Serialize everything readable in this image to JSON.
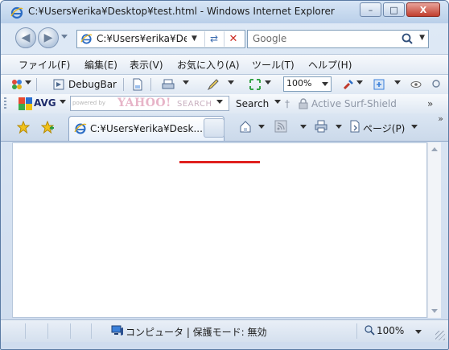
{
  "window": {
    "title": "C:¥Users¥erika¥Desktop¥test.html - Windows Internet Explorer",
    "buttons": {
      "minimize": "–",
      "maximize": "□",
      "close": "X"
    }
  },
  "address_bar": {
    "url": "C:¥Users¥erika¥De",
    "refresh": "⇄",
    "stop": "✕"
  },
  "search_box": {
    "placeholder": "Google",
    "icon": "magnifier-icon"
  },
  "menu": {
    "items": [
      {
        "label": "ファイル(F)"
      },
      {
        "label": "編集(E)"
      },
      {
        "label": "表示(V)"
      },
      {
        "label": "お気に入り(A)"
      },
      {
        "label": "ツール(T)"
      },
      {
        "label": "ヘルプ(H)"
      }
    ]
  },
  "toolbar1": {
    "debugbar_label": "DebugBar",
    "zoom_value": "100%"
  },
  "toolbar2": {
    "avg_label": "AVG",
    "powered_by": "powered by",
    "yahoo_logo": "YAHOO!",
    "yahoo_search": "SEARCH",
    "search_button": "Search",
    "active_surf_shield": "Active  Surf-Shield",
    "overflow": "»"
  },
  "tabs": {
    "active_tab_title": "C:¥Users¥erika¥Desk...",
    "page_menu_label": "ページ(P)",
    "overflow": "»"
  },
  "status_bar": {
    "zone_text": "コンピュータ | 保護モード: 無効",
    "zoom": "100%"
  },
  "colors": {
    "red_line": "#e0201e",
    "ie_blue": "#2b6cc4",
    "frame": "#5a7aa3"
  }
}
